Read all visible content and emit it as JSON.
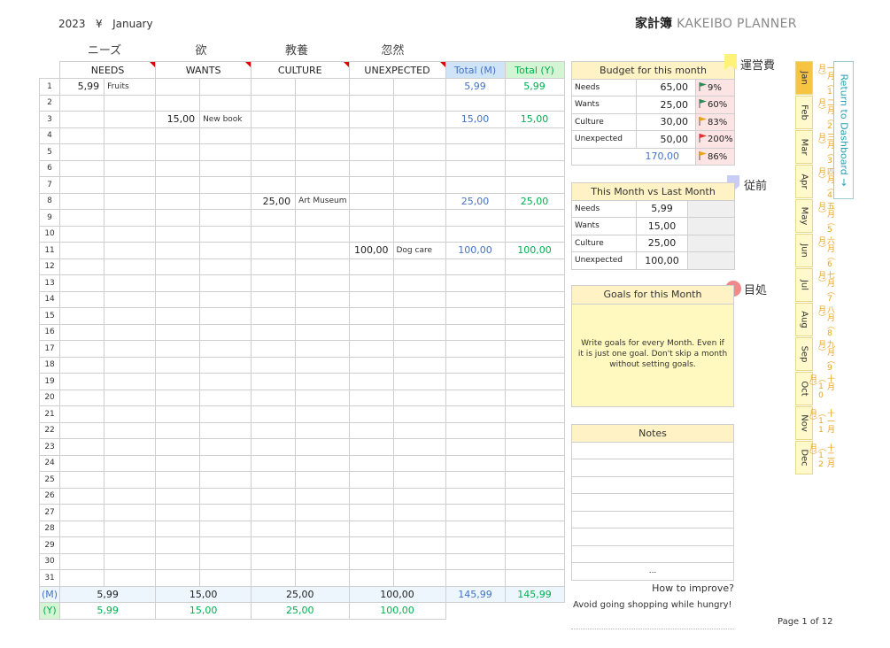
{
  "header": {
    "year": "2023",
    "currency": "¥",
    "month": "January",
    "title_jp": "家計簿",
    "title_en": "KAKEIBO PLANNER"
  },
  "jp_labels": [
    "ニーズ",
    "欲",
    "教養",
    "忽然"
  ],
  "columns": {
    "needs": "NEEDS",
    "wants": "WANTS",
    "culture": "CULTURE",
    "unexpected": "UNEXPECTED",
    "total_m": "Total (M)",
    "total_y": "Total (Y)"
  },
  "entries": [
    {
      "row": "1",
      "needs_amt": "5,99",
      "needs_desc": "Fruits",
      "tm": "5,99",
      "ty": "5,99"
    },
    {
      "row": "3",
      "wants_amt": "15,00",
      "wants_desc": "New book",
      "tm": "15,00",
      "ty": "15,00"
    },
    {
      "row": "8",
      "culture_amt": "25,00",
      "culture_desc": "Art Museum",
      "tm": "25,00",
      "ty": "25,00"
    },
    {
      "row": "11",
      "unexp_amt": "100,00",
      "unexp_desc": "Dog care",
      "tm": "100,00",
      "ty": "100,00"
    }
  ],
  "summary": {
    "m_label": "(M)",
    "y_label": "(Y)",
    "m": {
      "needs": "5,99",
      "wants": "15,00",
      "culture": "25,00",
      "unexpected": "100,00",
      "total_m": "145,99",
      "total_y": "145,99"
    },
    "y": {
      "needs": "5,99",
      "wants": "15,00",
      "culture": "25,00",
      "unexpected": "100,00"
    }
  },
  "budget": {
    "title": "Budget for this month",
    "rows": [
      {
        "label": "Needs",
        "value": "65,00",
        "pct": "9%",
        "flag": "#2e8b57"
      },
      {
        "label": "Wants",
        "value": "25,00",
        "pct": "60%",
        "flag": "#2e8b57"
      },
      {
        "label": "Culture",
        "value": "30,00",
        "pct": "83%",
        "flag": "#e8a31f"
      },
      {
        "label": "Unexpected",
        "value": "50,00",
        "pct": "200%",
        "flag": "#e03030"
      }
    ],
    "total": "170,00",
    "total_pct": "86%",
    "total_flag": "#e8a31f",
    "sticker": "運営費",
    "sticker_color": "#fff27a"
  },
  "compare": {
    "title": "This Month vs Last Month",
    "rows": [
      {
        "label": "Needs",
        "value": "5,99"
      },
      {
        "label": "Wants",
        "value": "15,00"
      },
      {
        "label": "Culture",
        "value": "25,00"
      },
      {
        "label": "Unexpected",
        "value": "100,00"
      }
    ],
    "sticker": "従前",
    "sticker_color": "#c8ccf7"
  },
  "goals": {
    "title": "Goals for this Month",
    "text": "Write goals for every Month. Even if it is just one goal. Don't skip a month without setting goals.",
    "sticker": "目処",
    "sticker_color": "#f08a8a"
  },
  "notes": {
    "title": "Notes",
    "ellipsis": "..."
  },
  "improve": {
    "question": "How to improve?",
    "answer": "Avoid going shopping while hungry!"
  },
  "page": "Page 1 of 12",
  "tabs": [
    "Jan",
    "Feb",
    "Mar",
    "Apr",
    "May",
    "Jun",
    "Jul",
    "Aug",
    "Sep",
    "Oct",
    "Nov",
    "Dec"
  ],
  "active_tab": "Jan",
  "kanji_tabs": [
    "一月（1月）",
    "二月（2月）",
    "三月（3月）",
    "四月（4月）",
    "五月（5月）",
    "六月（6月）",
    "七月（7月）",
    "八月（8月）",
    "九月（9月）",
    "十月（10月）",
    "十一月（11月）",
    "十二月（12月）"
  ],
  "dashboard_link": "Return to Dashboard →"
}
